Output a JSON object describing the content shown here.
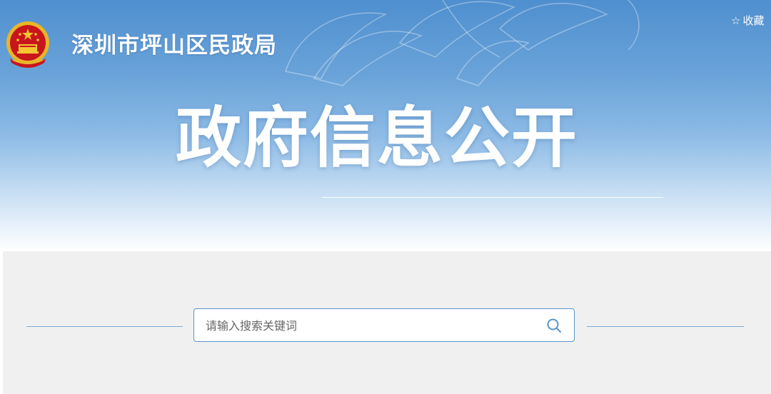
{
  "header": {
    "site_name": "深圳市坪山区民政局",
    "favorite_label": "收藏",
    "favorite_icon": "star-outline-icon"
  },
  "hero": {
    "title": "政府信息公开"
  },
  "search": {
    "placeholder": "请输入搜索关键词",
    "value": "",
    "button_icon": "search-icon"
  },
  "colors": {
    "banner_top": "#4f8fcf",
    "banner_bottom": "#ffffff",
    "search_border": "#5b93cc",
    "search_bg": "#f0f0f0",
    "emblem_red": "#c8161d",
    "emblem_gold": "#e8b628"
  }
}
